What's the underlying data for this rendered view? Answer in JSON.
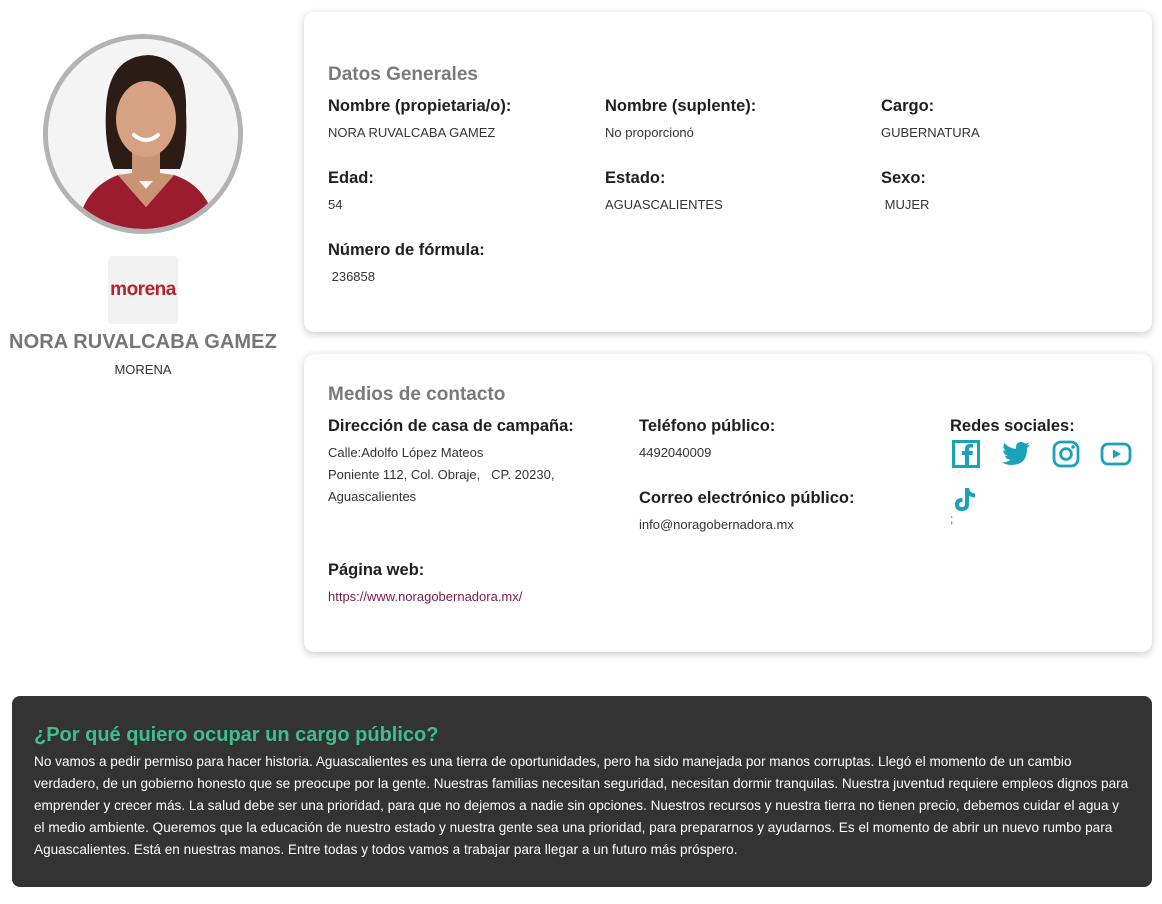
{
  "profile": {
    "name": "NORA RUVALCABA GAMEZ",
    "party": "MORENA",
    "party_logo_text": "morena",
    "photo_icon": "candidate-photo"
  },
  "general": {
    "title": "Datos Generales",
    "fields": {
      "nombre_propietaria": {
        "label": "Nombre (propietaria/o):",
        "value": "NORA RUVALCABA GAMEZ"
      },
      "nombre_suplente": {
        "label": "Nombre (suplente):",
        "value": "No proporcionó"
      },
      "cargo": {
        "label": "Cargo:",
        "value": "GUBERNATURA"
      },
      "edad": {
        "label": "Edad:",
        "value": "54"
      },
      "estado": {
        "label": "Estado:",
        "value": "AGUASCALIENTES"
      },
      "sexo": {
        "label": "Sexo:",
        "value": " MUJER"
      },
      "numero_formula": {
        "label": "Número de fórmula:",
        "value": " 236858"
      }
    }
  },
  "contact": {
    "title": "Medios de contacto",
    "direccion": {
      "label": "Dirección de casa de campaña:",
      "lines": [
        "Calle:Adolfo López Mateos",
        "Poniente 112, Col. Obraje,   CP. 20230,",
        "Aguascalientes"
      ]
    },
    "telefono": {
      "label": "Teléfono público:",
      "value": "4492040009"
    },
    "correo": {
      "label": "Correo electrónico público:",
      "value": "info@noragobernadora.mx"
    },
    "pagina": {
      "label": "Página web:",
      "value": "https://www.noragobernadora.mx/"
    },
    "redes": {
      "label": "Redes sociales:",
      "icons": [
        "facebook-icon",
        "twitter-icon",
        "instagram-icon",
        "youtube-icon",
        "tiktok-icon"
      ],
      "trailing": ";"
    }
  },
  "why": {
    "title": "¿Por qué quiero ocupar un cargo público?",
    "text": "No vamos a pedir permiso para hacer historia. Aguascalientes es una tierra de oportunidades, pero ha sido manejada por manos corruptas. Llegó el momento de un cambio verdadero, de un gobierno honesto que se preocupe por la gente. Nuestras familias necesitan seguridad, necesitan dormir tranquilas. Nuestra juventud requiere empleos dignos para emprender y crecer más. La salud debe ser una prioridad, para que no dejemos a nadie sin opciones. Nuestros recursos y nuestra tierra no tienen precio, debemos cuidar el agua y el medio ambiente. Queremos que la educación de nuestro estado y nuestra gente sea una prioridad, para prepararnos y ayudarnos. Es el momento de abrir un nuevo rumbo para Aguascalientes. Está en nuestras manos. Entre todas y todos vamos a trabajar para llegar a un futuro más próspero."
  },
  "colors": {
    "accent_green": "#3fbf8f",
    "social_teal": "#1aa3b8",
    "link_maroon": "#7a1a4a",
    "party_red": "#b5222b",
    "dark_box": "#333333"
  }
}
